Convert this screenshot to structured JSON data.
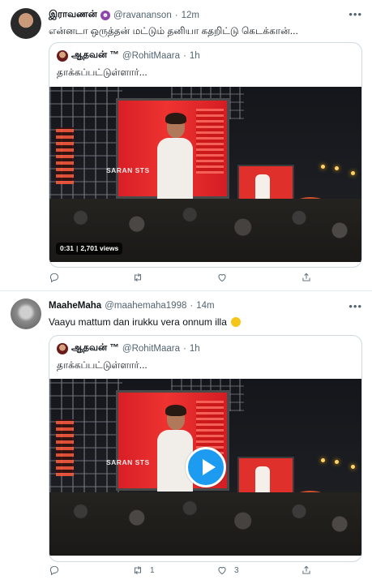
{
  "tweets": [
    {
      "author_name": "இராவணன்",
      "author_badge": "devil-emoji",
      "handle": "@ravananson",
      "dot": "·",
      "time": "12m",
      "more": "•••",
      "text": "என்னடா ஒருத்தன் மட்டும் தனியா கதறிட்டு கெடக்கான்...",
      "quote": {
        "author_name": "ஆதவன் ™",
        "handle": "@RohitMaara",
        "dot": "·",
        "time": "1h",
        "text": "தாக்கப்பட்டுள்ளார்...",
        "video_caption": "SARAN STS",
        "duration": "0:31",
        "views": "2,701 views"
      },
      "actions": {
        "reply": "",
        "retweet": "",
        "like": ""
      }
    },
    {
      "author_name": "MaaheMaha",
      "handle": "@maahemaha1998",
      "dot": "·",
      "time": "14m",
      "more": "•••",
      "text": "Vaayu mattum dan irukku vera onnum illa",
      "text_emoji": "laughing-face",
      "quote": {
        "author_name": "ஆதவன் ™",
        "handle": "@RohitMaara",
        "dot": "·",
        "time": "1h",
        "text": "தாக்கப்பட்டுள்ளார்...",
        "video_caption": "SARAN STS"
      },
      "actions": {
        "reply": "",
        "retweet": "1",
        "like": "3"
      }
    }
  ],
  "colors": {
    "accent": "#1d9bf0",
    "text_secondary": "#536471",
    "border": "#cfd9de",
    "stage_red": "#e8302c"
  },
  "icons": [
    "reply-icon",
    "retweet-icon",
    "like-icon",
    "share-icon",
    "play-icon",
    "more-icon"
  ]
}
